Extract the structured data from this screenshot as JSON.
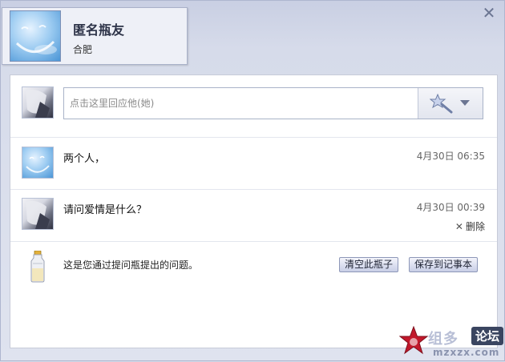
{
  "window": {
    "close_label": "✕",
    "icon": "close-icon"
  },
  "profile": {
    "name": "匿名瓶友",
    "location": "合肥"
  },
  "reply": {
    "placeholder": "点击这里回应他(她)",
    "emoji_icon": "magic-wand-icon"
  },
  "messages": [
    {
      "text": "两个人，",
      "time": "4月30日 06:35",
      "avatar": "sky-avatar"
    },
    {
      "text": "请问爱情是什么？",
      "time": "4月30日 00:39",
      "avatar": "boy-avatar",
      "delete_label": "删除"
    }
  ],
  "footer": {
    "info": "这是您通过提问瓶提出的问题。",
    "clear_button": "清空此瓶子",
    "save_button": "保存到记事本",
    "bottle_icon": "bottle-icon"
  },
  "watermark": {
    "text1": "组多",
    "text_box": "论坛",
    "text2": "mzxzx.com"
  }
}
